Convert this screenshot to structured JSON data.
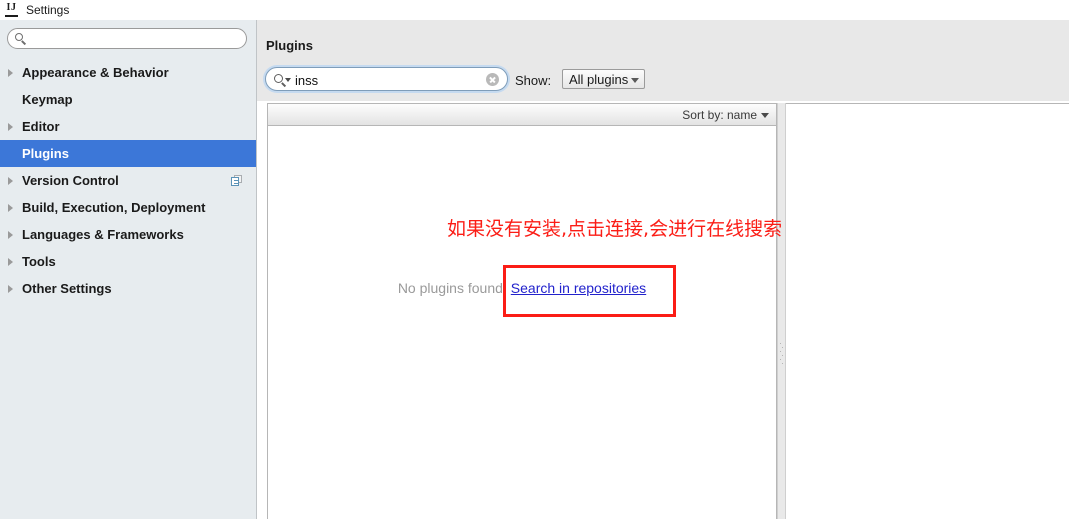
{
  "window": {
    "title": "Settings",
    "app_icon": "intellij-idea-icon"
  },
  "sidebar": {
    "search": {
      "value": "",
      "placeholder": "",
      "icon": "search-icon"
    },
    "items": [
      {
        "label": "Appearance & Behavior",
        "expandable": true,
        "selected": false,
        "trailing_icon": ""
      },
      {
        "label": "Keymap",
        "expandable": false,
        "selected": false,
        "trailing_icon": ""
      },
      {
        "label": "Editor",
        "expandable": true,
        "selected": false,
        "trailing_icon": ""
      },
      {
        "label": "Plugins",
        "expandable": false,
        "selected": true,
        "trailing_icon": ""
      },
      {
        "label": "Version Control",
        "expandable": true,
        "selected": false,
        "trailing_icon": "copy-pages-icon"
      },
      {
        "label": "Build, Execution, Deployment",
        "expandable": true,
        "selected": false,
        "trailing_icon": ""
      },
      {
        "label": "Languages & Frameworks",
        "expandable": true,
        "selected": false,
        "trailing_icon": ""
      },
      {
        "label": "Tools",
        "expandable": true,
        "selected": false,
        "trailing_icon": ""
      },
      {
        "label": "Other Settings",
        "expandable": true,
        "selected": false,
        "trailing_icon": ""
      }
    ]
  },
  "main": {
    "title": "Plugins",
    "search": {
      "value": "inss",
      "placeholder": "",
      "icon": "search-icon",
      "clear_icon": "clear-circle-icon"
    },
    "show_label": "Show:",
    "show_value": "All plugins",
    "sort_by": "Sort by: name",
    "empty_text": "No plugins found.",
    "empty_link": "Search in repositories"
  },
  "annotations": {
    "note": "如果没有安装,点击连接,会进行在线搜索",
    "color": "#fb1d16"
  },
  "colors": {
    "selection_blue": "#3c77d8",
    "sidebar_bg": "#e7ecef",
    "header_bg": "#e8e8e8",
    "link_blue": "#2222cc",
    "muted_text": "#9a9a9a",
    "annotation_red": "#fb1d16"
  }
}
